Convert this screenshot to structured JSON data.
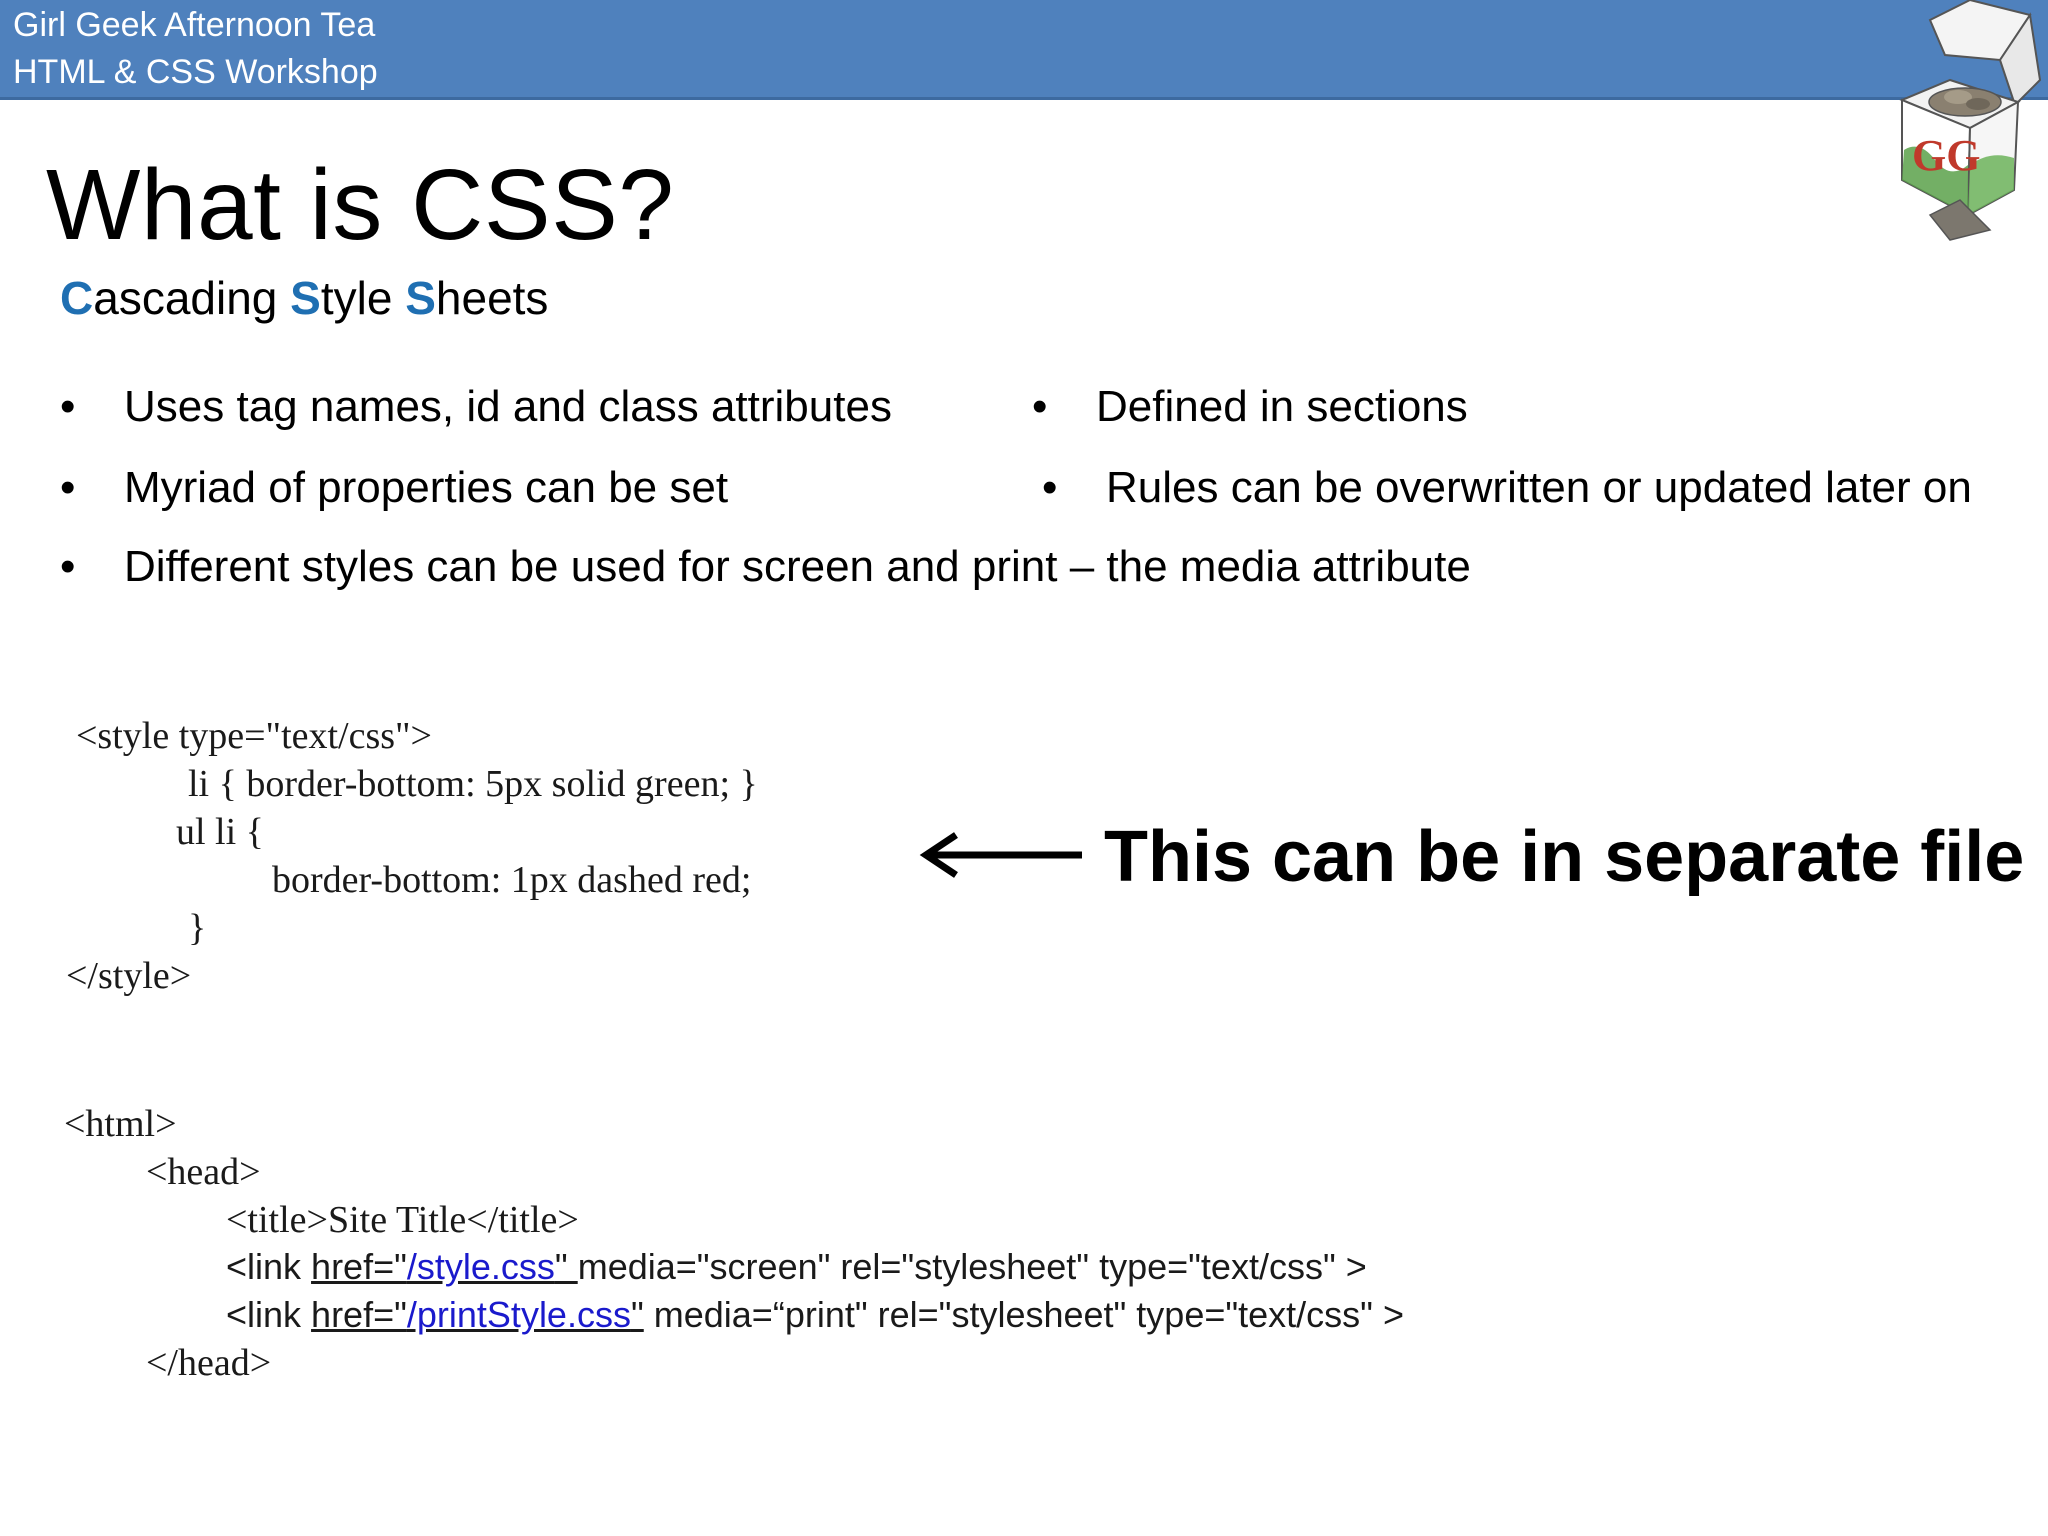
{
  "header": {
    "line1": "Girl Geek Afternoon Tea",
    "line2": "HTML & CSS Workshop"
  },
  "logo": {
    "icon": "gg-tea-box-logo",
    "text": "GG"
  },
  "title": "What is CSS?",
  "subtitle": {
    "c_initial": "C",
    "c_rest": "ascading ",
    "s1_initial": "S",
    "s1_rest": "tyle ",
    "s2_initial": "S",
    "s2_rest": "heets",
    "accent_color": "#1f6fb2"
  },
  "bullets": {
    "left": [
      "Uses tag names, id and class attributes",
      "Myriad of properties can be set",
      "Different styles can be used for screen and print – the media attribute"
    ],
    "right": [
      "Defined in sections",
      "Rules can be overwritten or updated later on"
    ],
    "marker": "•"
  },
  "style_code": {
    "open": "<style type=\"text/css\">",
    "rule1": "li { border-bottom: 5px solid green; }",
    "rule2_open": "ul li {",
    "rule2_body": "border-bottom: 1px dashed red;",
    "rule2_close": "}",
    "close": "</style>"
  },
  "callout": {
    "arrow_icon": "left-arrow-icon",
    "text": "This can be in separate file"
  },
  "html_code": {
    "html_open": "<html>",
    "head_open": "<head>",
    "title_line": "<title>Site Title</title>",
    "link1": {
      "prefix": "<link ",
      "href_attr": "href=\"",
      "href_value": "/style.css",
      "href_close": "\" ",
      "rest": "media=\"screen\" rel=\"stylesheet\" type=\"text/css\" >"
    },
    "link2": {
      "prefix": "<link ",
      "href_attr": "href=\"",
      "href_value": "/printStyle.css",
      "href_close": "\"",
      "rest": " media=“print\" rel=\"stylesheet\" type=\"text/css\" >"
    },
    "head_close": "</head>"
  }
}
